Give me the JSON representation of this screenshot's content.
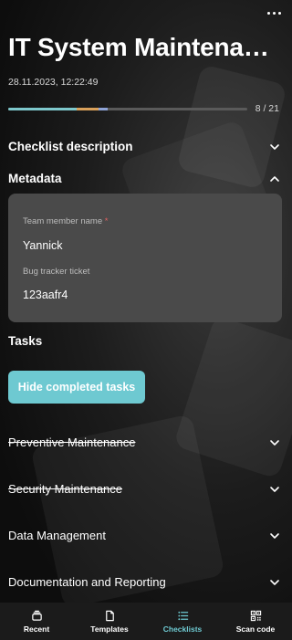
{
  "header": {
    "title": "IT System Maintenance Checklist",
    "timestamp": "28.11.2023, 12:22:49"
  },
  "progress": {
    "completed": 8,
    "total": 21,
    "label": "8 / 21"
  },
  "sections": {
    "checklist_description": "Checklist description",
    "metadata": "Metadata"
  },
  "metadata_fields": {
    "team_member": {
      "label": "Team member name",
      "required_mark": "*",
      "value": "Yannick"
    },
    "bug_tracker": {
      "label": "Bug tracker ticket",
      "value": "123aafr4"
    }
  },
  "tasks": {
    "heading": "Tasks",
    "hide_button": "Hide completed tasks",
    "groups": [
      {
        "label": "Preventive Maintenance",
        "completed": true
      },
      {
        "label": "Security Maintenance",
        "completed": true
      },
      {
        "label": "Data Management",
        "completed": false
      },
      {
        "label": "Documentation and Reporting",
        "completed": false
      }
    ]
  },
  "bottom_nav": {
    "recent": "Recent",
    "templates": "Templates",
    "checklists": "Checklists",
    "scan": "Scan code",
    "active": "checklists"
  },
  "colors": {
    "accent": "#6ec9d1",
    "card": "#4a4a4a",
    "required": "#e06060"
  },
  "icons": [
    "more-icon",
    "chevron-down-icon",
    "chevron-up-icon",
    "recent-icon",
    "templates-icon",
    "checklists-icon",
    "qr-code-icon"
  ]
}
